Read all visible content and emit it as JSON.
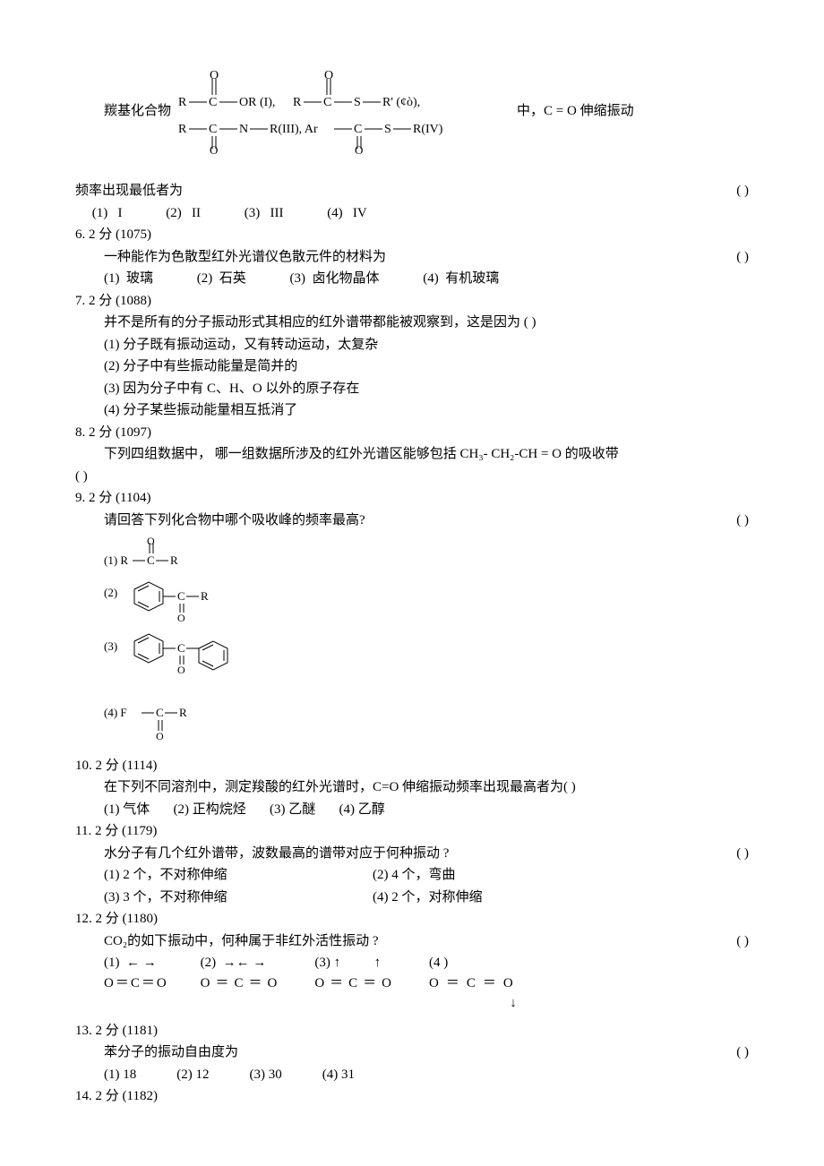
{
  "q5": {
    "lead": "羰基化合物",
    "tail": "中，C = O  伸缩振动",
    "line2": "频率出现最低者为",
    "opts": "     (1)   I             (2)   II             (3)   III             (4)   IV"
  },
  "q6": {
    "header": "6.    2 分  (1075)",
    "body": "一种能作为色散型红外光谱仪色散元件的材料为",
    "opts": "(1)  玻璃             (2)  石英             (3)  卤化物晶体             (4)  有机玻璃"
  },
  "q7": {
    "header": "7.    2 分  (1088)",
    "body": "并不是所有的分子振动形式其相应的红外谱带都能被观察到，这是因为    (           )",
    "o1": "(1)  分子既有振动运动，又有转动运动，太复杂",
    "o2": "(2)  分子中有些振动能量是简并的",
    "o3": "(3)  因为分子中有 C、H、O 以外的原子存在",
    "o4": "(4)  分子某些振动能量相互抵消了"
  },
  "q8": {
    "header": "8.    2 分  (1097)",
    "body": "下列四组数据中， 哪一组数据所涉及的红外光谱区能够包括   CH₃- CH₂-CH = O 的吸收带",
    "blank": "(           )"
  },
  "q9": {
    "header": "9.    2 分  (1104)",
    "body": "请回答下列化合物中哪个吸收峰的频率最高?"
  },
  "q10": {
    "header": "10.    2 分  (1114)",
    "body": "在下列不同溶剂中，测定羧酸的红外光谱时，C=O 伸缩振动频率出现最高者为(         )",
    "opts": "(1) 气体       (2) 正构烷烃       (3) 乙醚       (4) 乙醇"
  },
  "q11": {
    "header": "11.    2 分  (1179)",
    "body": "水分子有几个红外谱带，波数最高的谱带对应于何种振动  ?",
    "o1a": "(1) 2 个，不对称伸缩",
    "o1b": "(2) 4 个，弯曲",
    "o2a": "(3) 3 个，不对称伸缩",
    "o2b": "(4) 2 个，对称伸缩"
  },
  "q12": {
    "header": "12.    2 分  (1180)",
    "body": "CO₂的如下振动中，何种属于非红外活性振动  ?",
    "labels": [
      "(1)",
      "(2)",
      "(3)",
      "(4 )"
    ],
    "arrows": [
      "←  →",
      "→←   →",
      "↑          ↑",
      ""
    ],
    "formula": "O＝C＝O"
  },
  "q13": {
    "header": "13.    2 分  (1181)",
    "body": "苯分子的振动自由度为",
    "opts": "(1) 18            (2) 12            (3) 30            (4) 31"
  },
  "q14": {
    "header": "14.    2 分  (1182)"
  },
  "paren": "(           )",
  "paren_narrow": "(        )"
}
